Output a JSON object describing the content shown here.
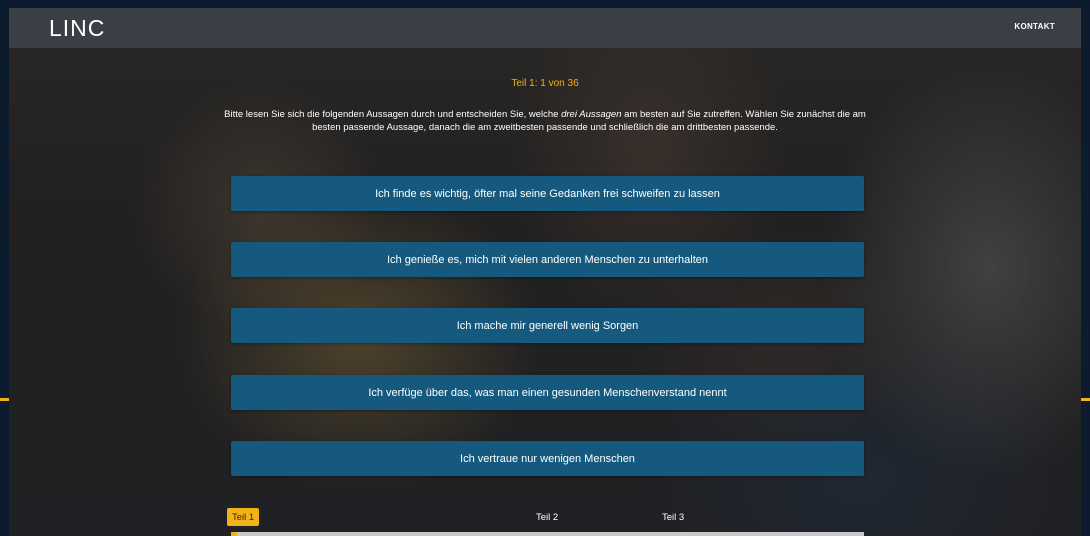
{
  "header": {
    "logo": "LINC",
    "nav_contact": "KONTAKT"
  },
  "progress": {
    "label": "Teil 1: 1 von 36",
    "current": 1,
    "total": 36
  },
  "instructions": {
    "before_em": "Bitte lesen Sie sich die folgenden Aussagen durch und entscheiden Sie, welche ",
    "em": "drei Aussagen",
    "after_em": " am besten auf Sie zutreffen. Wählen Sie zunächst die am besten passende Aussage, danach die am zweitbesten passende und schließlich die am drittbesten passende."
  },
  "statements": [
    "Ich finde es wichtig, öfter mal seine Gedanken frei schweifen zu lassen",
    "Ich genieße es, mich mit vielen anderen Menschen zu unterhalten",
    "Ich mache mir generell wenig Sorgen",
    "Ich verfüge über das, was man einen gesunden Menschenverstand nennt",
    "Ich vertraue nur wenigen Menschen"
  ],
  "sections": [
    {
      "label": "Teil 1",
      "active": true
    },
    {
      "label": "Teil 2",
      "active": false
    },
    {
      "label": "Teil 3",
      "active": false
    }
  ],
  "colors": {
    "accent": "#f2b21a",
    "button": "#155a7e",
    "header": "#3c4048"
  }
}
